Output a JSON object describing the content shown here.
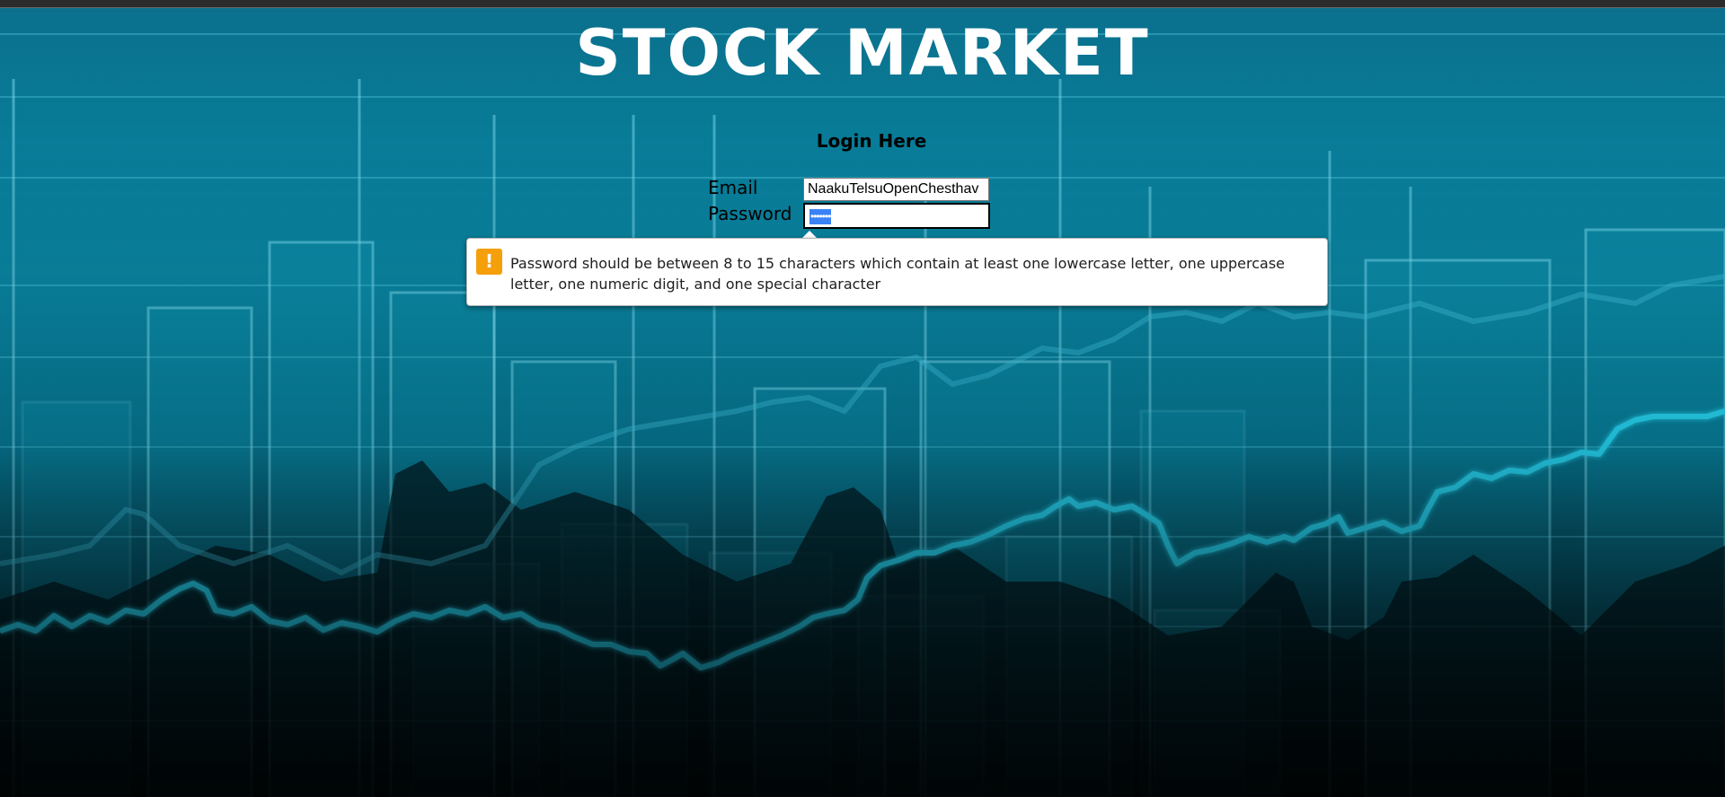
{
  "page": {
    "title": "STOCK MARKET"
  },
  "login": {
    "heading": "Login Here",
    "email_label": "Email",
    "email_value": "NaakuTelsuOpenChesthav",
    "password_label": "Password",
    "password_mask": "•••••••"
  },
  "validation": {
    "icon": "warning-icon",
    "icon_glyph": "!",
    "message": "Password should be between 8 to 15 characters which contain at least one lowercase letter, one uppercase letter, one numeric digit, and one special character",
    "icon_color": "#f59f0b"
  },
  "theme": {
    "background_accent": "#0a88a6",
    "chart_line": "#2ee0ff"
  }
}
